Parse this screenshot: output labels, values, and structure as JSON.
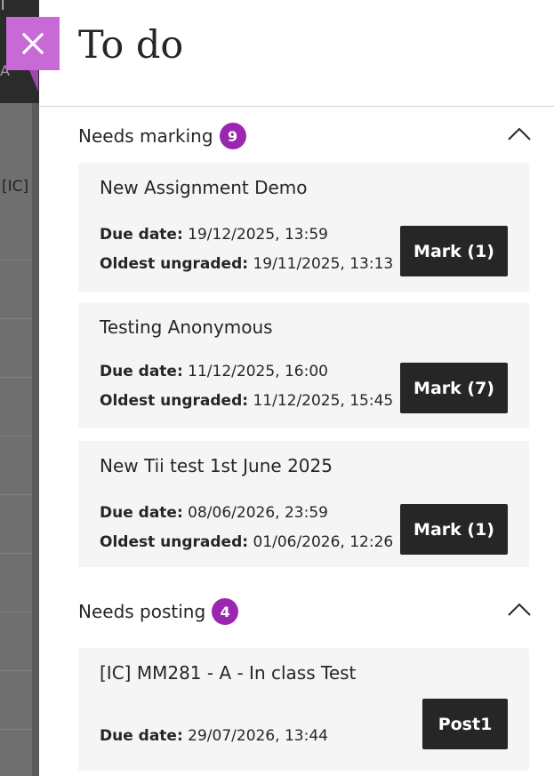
{
  "title": "To do",
  "close_icon": "close-icon",
  "backdrop": {
    "t1": "T",
    "t2": "A",
    "t3": "[IC] M"
  },
  "needs_marking": {
    "label": "Needs marking",
    "count": "9",
    "items": [
      {
        "name": "New Assignment Demo",
        "due_label": "Due date:",
        "due": "19/12/2025, 13:59",
        "oldest_label": "Oldest ungraded:",
        "oldest": "19/11/2025, 13:13",
        "action": "Mark (1)"
      },
      {
        "name": "Testing Anonymous",
        "due_label": "Due date:",
        "due": "11/12/2025, 16:00",
        "oldest_label": "Oldest ungraded:",
        "oldest": "11/12/2025, 15:45",
        "action": "Mark (7)"
      },
      {
        "name": "New Tii test 1st June 2025",
        "due_label": "Due date:",
        "due": "08/06/2026, 23:59",
        "oldest_label": "Oldest ungraded:",
        "oldest": "01/06/2026, 12:26",
        "action": "Mark (1)"
      }
    ]
  },
  "needs_posting": {
    "label": "Needs posting",
    "count": "4",
    "items": [
      {
        "name": "[IC] MM281 - A - In class Test",
        "due_label": "Due date:",
        "due": "29/07/2026, 13:44",
        "action": "Post1"
      }
    ]
  },
  "colors": {
    "accent": "#9b27b0",
    "close_bg": "#c86ad6",
    "button_bg": "#262626",
    "card_bg": "#f5f5f5"
  }
}
